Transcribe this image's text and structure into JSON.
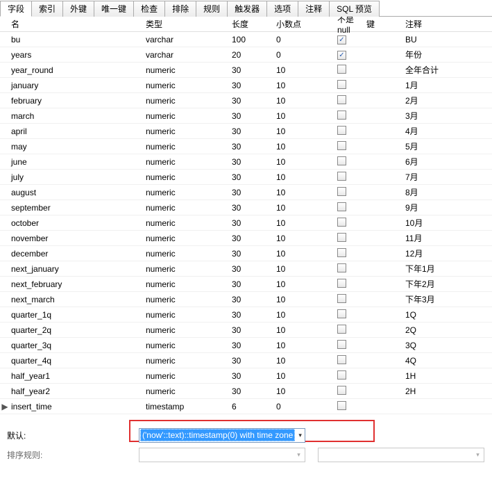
{
  "tabs": {
    "items": [
      "字段",
      "索引",
      "外键",
      "唯一键",
      "检查",
      "排除",
      "规则",
      "触发器",
      "选项",
      "注释",
      "SQL 预览"
    ],
    "active_index": 0
  },
  "columns": {
    "name": "名",
    "type": "类型",
    "length": "长度",
    "decimal": "小数点",
    "notnull": "不是 null",
    "key": "键",
    "comment": "注释"
  },
  "rows": [
    {
      "name": "bu",
      "type": "varchar",
      "len": "100",
      "dec": "0",
      "nn": true,
      "comment": "BU"
    },
    {
      "name": "years",
      "type": "varchar",
      "len": "20",
      "dec": "0",
      "nn": true,
      "comment": "年份"
    },
    {
      "name": "year_round",
      "type": "numeric",
      "len": "30",
      "dec": "10",
      "nn": false,
      "comment": "全年合计"
    },
    {
      "name": "january",
      "type": "numeric",
      "len": "30",
      "dec": "10",
      "nn": false,
      "comment": "1月"
    },
    {
      "name": "february",
      "type": "numeric",
      "len": "30",
      "dec": "10",
      "nn": false,
      "comment": "2月"
    },
    {
      "name": "march",
      "type": "numeric",
      "len": "30",
      "dec": "10",
      "nn": false,
      "comment": "3月"
    },
    {
      "name": "april",
      "type": "numeric",
      "len": "30",
      "dec": "10",
      "nn": false,
      "comment": "4月"
    },
    {
      "name": "may",
      "type": "numeric",
      "len": "30",
      "dec": "10",
      "nn": false,
      "comment": "5月"
    },
    {
      "name": "june",
      "type": "numeric",
      "len": "30",
      "dec": "10",
      "nn": false,
      "comment": "6月"
    },
    {
      "name": "july",
      "type": "numeric",
      "len": "30",
      "dec": "10",
      "nn": false,
      "comment": "7月"
    },
    {
      "name": "august",
      "type": "numeric",
      "len": "30",
      "dec": "10",
      "nn": false,
      "comment": "8月"
    },
    {
      "name": "september",
      "type": "numeric",
      "len": "30",
      "dec": "10",
      "nn": false,
      "comment": "9月"
    },
    {
      "name": "october",
      "type": "numeric",
      "len": "30",
      "dec": "10",
      "nn": false,
      "comment": "10月"
    },
    {
      "name": "november",
      "type": "numeric",
      "len": "30",
      "dec": "10",
      "nn": false,
      "comment": "11月"
    },
    {
      "name": "december",
      "type": "numeric",
      "len": "30",
      "dec": "10",
      "nn": false,
      "comment": "12月"
    },
    {
      "name": "next_january",
      "type": "numeric",
      "len": "30",
      "dec": "10",
      "nn": false,
      "comment": "下年1月"
    },
    {
      "name": "next_february",
      "type": "numeric",
      "len": "30",
      "dec": "10",
      "nn": false,
      "comment": "下年2月"
    },
    {
      "name": "next_march",
      "type": "numeric",
      "len": "30",
      "dec": "10",
      "nn": false,
      "comment": "下年3月"
    },
    {
      "name": "quarter_1q",
      "type": "numeric",
      "len": "30",
      "dec": "10",
      "nn": false,
      "comment": "1Q"
    },
    {
      "name": "quarter_2q",
      "type": "numeric",
      "len": "30",
      "dec": "10",
      "nn": false,
      "comment": "2Q"
    },
    {
      "name": "quarter_3q",
      "type": "numeric",
      "len": "30",
      "dec": "10",
      "nn": false,
      "comment": "3Q"
    },
    {
      "name": "quarter_4q",
      "type": "numeric",
      "len": "30",
      "dec": "10",
      "nn": false,
      "comment": "4Q"
    },
    {
      "name": "half_year1",
      "type": "numeric",
      "len": "30",
      "dec": "10",
      "nn": false,
      "comment": "1H"
    },
    {
      "name": "half_year2",
      "type": "numeric",
      "len": "30",
      "dec": "10",
      "nn": false,
      "comment": "2H"
    },
    {
      "name": "insert_time",
      "type": "timestamp",
      "len": "6",
      "dec": "0",
      "nn": false,
      "comment": "",
      "marker": "▶"
    }
  ],
  "bottom": {
    "default_label": "默认:",
    "default_value": "('now'::text)::timestamp(0) with time zone",
    "sort_label": "排序规则:"
  },
  "checkmark": "✓"
}
